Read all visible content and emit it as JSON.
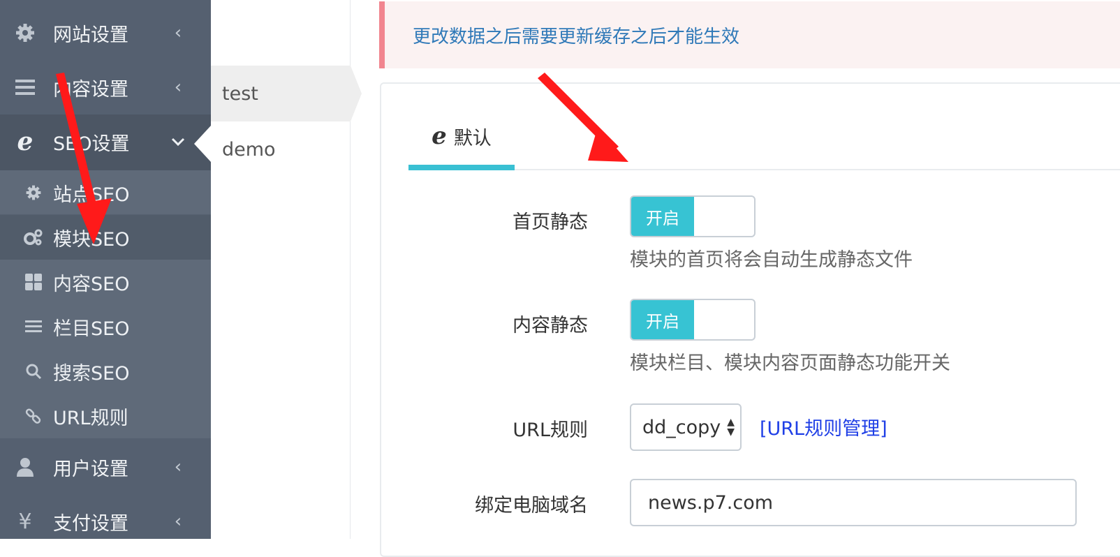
{
  "sidebar": {
    "top_items": [
      {
        "label": "网站设置",
        "icon": "gear-icon"
      },
      {
        "label": "内容设置",
        "icon": "list-icon"
      },
      {
        "label": "SEO设置",
        "icon": "ie-icon"
      }
    ],
    "sub_items": [
      {
        "label": "站点SEO",
        "icon": "gear-icon"
      },
      {
        "label": "模块SEO",
        "icon": "gears-icon"
      },
      {
        "label": "内容SEO",
        "icon": "grid-icon"
      },
      {
        "label": "栏目SEO",
        "icon": "list-icon"
      },
      {
        "label": "搜索SEO",
        "icon": "search-icon"
      },
      {
        "label": "URL规则",
        "icon": "link-icon"
      }
    ],
    "bottom_items": [
      {
        "label": "用户设置",
        "icon": "user-icon"
      },
      {
        "label": "支付设置",
        "icon": "yen-icon"
      }
    ]
  },
  "module_list": {
    "items": [
      "test",
      "demo"
    ]
  },
  "alert": {
    "text": "更改数据之后需要更新缓存之后才能生效",
    "accent_color": "#f1858f"
  },
  "tabs": [
    {
      "label": "默认",
      "icon": "ie-icon",
      "active": true
    }
  ],
  "form": {
    "home_static": {
      "label": "首页静态",
      "toggle_on_label": "开启",
      "help": "模块的首页将会自动生成静态文件"
    },
    "content_static": {
      "label": "内容静态",
      "toggle_on_label": "开启",
      "help": "模块栏目、模块内容页面静态功能开关"
    },
    "url_rule": {
      "label": "URL规则",
      "selected": "dd_copy",
      "manage_link": "[URL规则管理]"
    },
    "pc_domain": {
      "label": "绑定电脑域名",
      "value": "news.p7.com"
    }
  },
  "colors": {
    "sidebar_bg": "#556070",
    "accent": "#37c3d3",
    "annotation_arrow": "#ff1a1a"
  }
}
